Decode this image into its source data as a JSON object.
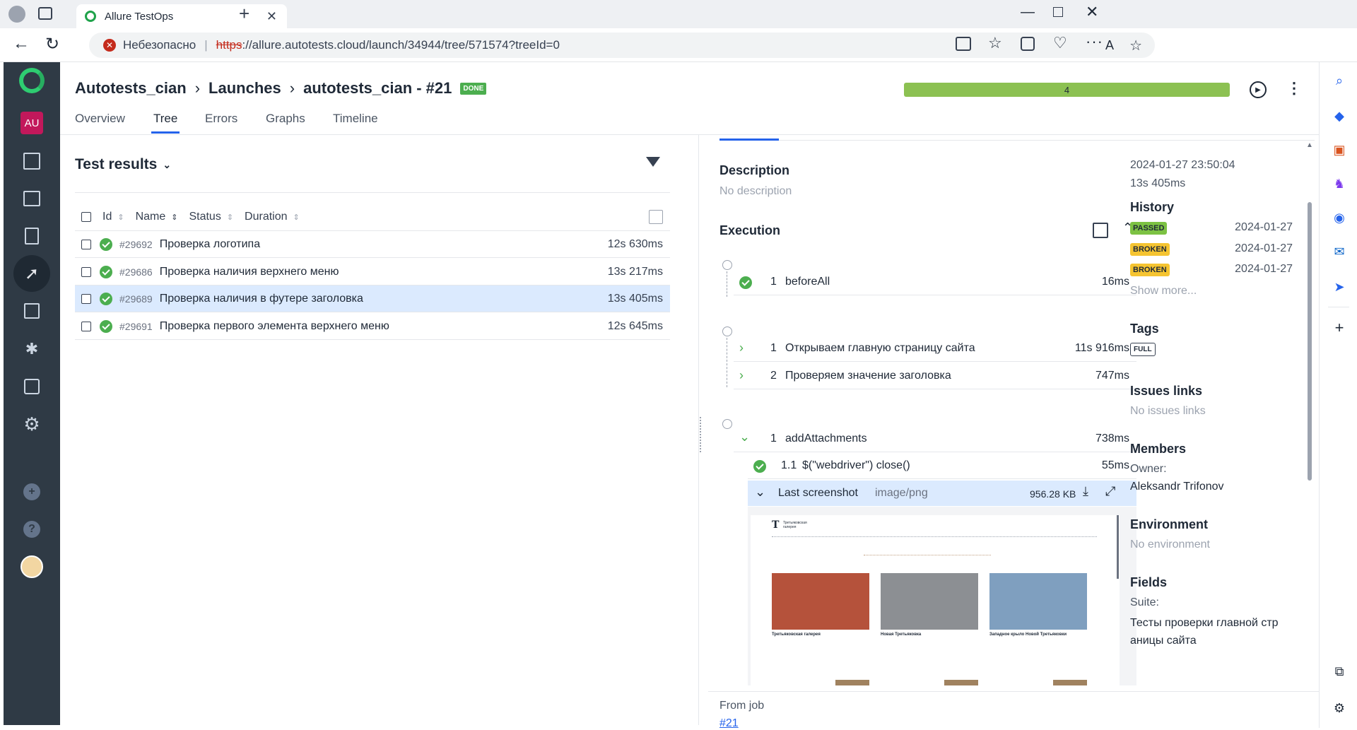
{
  "browser": {
    "tab_title": "Allure TestOps",
    "security_label": "Небезопасно",
    "url_scheme": "https",
    "url_rest": "://allure.autotests.cloud/launch/34944/tree/571574?treeId=0"
  },
  "nav": {
    "logo_icon": "allure-logo-icon",
    "avatar_initials": "AU",
    "items": [
      "dashboard-icon",
      "launches-list-icon",
      "test-cases-icon",
      "launches-icon",
      "analytics-icon",
      "defects-icon",
      "jobs-icon",
      "settings-icon"
    ],
    "bottom": [
      "add-icon",
      "help-icon",
      "user-avatar"
    ]
  },
  "header": {
    "crumbs": [
      "Autotests_cian",
      "Launches",
      "autotests_cian - #21"
    ],
    "status_badge": "DONE",
    "progress_count": "4",
    "tabs": [
      "Overview",
      "Tree",
      "Errors",
      "Graphs",
      "Timeline"
    ],
    "active_tab": "Tree"
  },
  "results": {
    "title": "Test results",
    "columns": [
      "Id",
      "Name",
      "Status",
      "Duration"
    ],
    "rows": [
      {
        "id": "#29692",
        "name": "Проверка логотипа",
        "duration": "12s 630ms"
      },
      {
        "id": "#29686",
        "name": "Проверка наличия верхнего меню",
        "duration": "13s 217ms"
      },
      {
        "id": "#29689",
        "name": "Проверка наличия в футере заголовка",
        "duration": "13s 405ms"
      },
      {
        "id": "#29691",
        "name": "Проверка первого элемента верхнего меню",
        "duration": "12s 645ms"
      }
    ]
  },
  "detail": {
    "description_title": "Description",
    "description_text": "No description",
    "execution_title": "Execution",
    "before": {
      "num": "1",
      "name": "beforeAll",
      "duration": "16ms"
    },
    "steps": [
      {
        "num": "1",
        "name": "Открываем главную страницу сайта",
        "duration": "11s 916ms"
      },
      {
        "num": "2",
        "name": "Проверяем значение заголовка",
        "duration": "747ms"
      }
    ],
    "after": {
      "num": "1",
      "name": "addAttachments",
      "duration": "738ms"
    },
    "substep": {
      "num": "1.1",
      "name": "$(\"webdriver\") close()",
      "duration": "55ms"
    },
    "attachment": {
      "name": "Last screenshot",
      "type": "image/png",
      "size": "956.28 KB"
    },
    "from_job_label": "From job",
    "from_job_link": "#21"
  },
  "screenshot": {
    "site_title": "Третьяковская галерея",
    "cards": [
      "Третьяковская галерея",
      "Новая Третьяковка",
      "Западное крыло Новой Третьяковки"
    ]
  },
  "meta": {
    "datetime": "2024-01-27 23:50:04",
    "duration": "13s 405ms",
    "history_title": "History",
    "history": [
      {
        "status": "PASSED",
        "date": "2024-01-27",
        "color": "#7cc243"
      },
      {
        "status": "BROKEN",
        "date": "2024-01-27",
        "color": "#f5c431"
      },
      {
        "status": "BROKEN",
        "date": "2024-01-27",
        "color": "#f5c431"
      }
    ],
    "show_more": "Show more...",
    "tags_title": "Tags",
    "tag": "FULL",
    "issues_title": "Issues links",
    "issues_text": "No issues links",
    "members_title": "Members",
    "owner_label": "Owner:",
    "owner_name": "Aleksandr Trifonov",
    "env_title": "Environment",
    "env_text": "No environment",
    "fields_title": "Fields",
    "suite_label": "Suite:",
    "suite_value": "Тесты проверки главной страницы сайта"
  }
}
